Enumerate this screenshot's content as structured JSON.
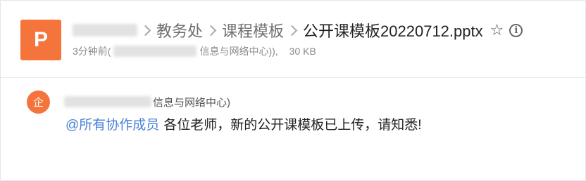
{
  "file": {
    "icon_letter": "P",
    "icon_color": "#f4743b",
    "breadcrumbs": [
      "教务处",
      "课程模板"
    ],
    "filename": "公开课模板20220712.pptx",
    "star_icon": "star-outline-icon",
    "info_icon": "info-circle-icon",
    "meta_time": "3分钟前(",
    "meta_dept": "信息与网络中心)),",
    "meta_size": "30 KB"
  },
  "comment": {
    "avatar_text": "企",
    "avatar_color": "#f4743b",
    "sender_dept": "信息与网络中心)",
    "mention": "@所有协作成员",
    "message": "各位老师，新的公开课模板已上传，请知悉!",
    "mention_color": "#4a7fd8"
  }
}
